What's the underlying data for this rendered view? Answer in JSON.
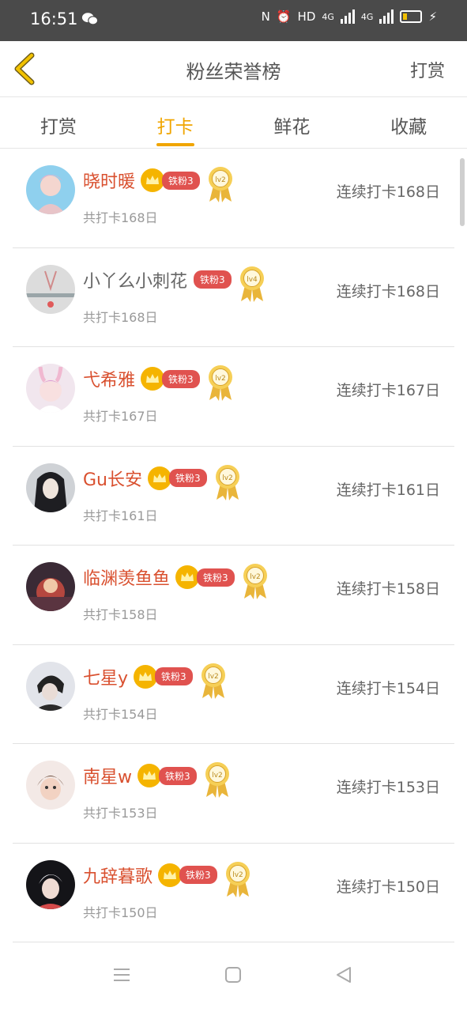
{
  "status_bar": {
    "time": "16:51",
    "net_label": "HD",
    "network1": "4G",
    "network2": "4G"
  },
  "header": {
    "title": "粉丝荣誉榜",
    "right_action": "打赏"
  },
  "tabs": [
    {
      "label": "打赏",
      "active": false
    },
    {
      "label": "打卡",
      "active": true
    },
    {
      "label": "鲜花",
      "active": false
    },
    {
      "label": "收藏",
      "active": false
    }
  ],
  "rows": [
    {
      "name": "晓时暖",
      "badge": "铁粉3",
      "level": "lv2",
      "total": "共打卡168日",
      "streak": "连续打卡168日",
      "crown": true
    },
    {
      "name": "小丫么小刺花",
      "badge": "铁粉3",
      "level": "lv4",
      "total": "共打卡168日",
      "streak": "连续打卡168日",
      "crown": false
    },
    {
      "name": "弋希雅",
      "badge": "铁粉3",
      "level": "lv2",
      "total": "共打卡167日",
      "streak": "连续打卡167日",
      "crown": true
    },
    {
      "name": "Gu长安",
      "badge": "铁粉3",
      "level": "lv2",
      "total": "共打卡161日",
      "streak": "连续打卡161日",
      "crown": true
    },
    {
      "name": "临渊羡鱼鱼",
      "badge": "铁粉3",
      "level": "lv2",
      "total": "共打卡158日",
      "streak": "连续打卡158日",
      "crown": true
    },
    {
      "name": "七星y",
      "badge": "铁粉3",
      "level": "lv2",
      "total": "共打卡154日",
      "streak": "连续打卡154日",
      "crown": true
    },
    {
      "name": "南星w",
      "badge": "铁粉3",
      "level": "lv2",
      "total": "共打卡153日",
      "streak": "连续打卡153日",
      "crown": true
    },
    {
      "name": "九辞暮歌",
      "badge": "铁粉3",
      "level": "lv2",
      "total": "共打卡150日",
      "streak": "连续打卡150日",
      "crown": true
    }
  ],
  "colors": {
    "accent": "#f0a500",
    "name_red": "#d9502f",
    "badge_red": "#e0524f"
  }
}
